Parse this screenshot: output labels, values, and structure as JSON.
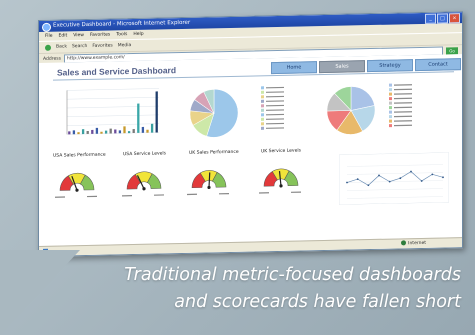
{
  "window": {
    "title": "Executive Dashboard - Microsoft Internet Explorer",
    "controls": [
      "_",
      "□",
      "×"
    ],
    "menu": [
      "File",
      "Edit",
      "View",
      "Favorites",
      "Tools",
      "Help"
    ],
    "toolbar": [
      "Back",
      "Search",
      "Favorites",
      "Media"
    ],
    "address_label": "Address",
    "address": "http://www.example.com/",
    "go": "Go"
  },
  "dashboard": {
    "title": "Sales and Service Dashboard",
    "nav": [
      "Home",
      "Sales",
      "Strategy",
      "Contact"
    ],
    "nav_active": 1,
    "gauges": [
      {
        "title": "USA Sales Performance"
      },
      {
        "title": "USA Service Levels"
      },
      {
        "title": "UK Sales Performance"
      },
      {
        "title": "UK Service Levels"
      }
    ]
  },
  "status": {
    "zone": "Internet"
  },
  "caption": {
    "line1": "Traditional metric-focused dashboards",
    "line2": "and scorecards have fallen short"
  },
  "colors": {
    "gauge_red": "#e2393a",
    "gauge_yellow": "#f1e43a",
    "gauge_green": "#86c35a",
    "nav_blue": "#8fb9e3",
    "title_blue": "#55618a"
  },
  "chart_data": [
    {
      "type": "bar",
      "title": "",
      "values": [
        3,
        4,
        2,
        5,
        3,
        4,
        6,
        2,
        3,
        5,
        4,
        3,
        7,
        2,
        4,
        30,
        6,
        3,
        9,
        42
      ],
      "categories": []
    },
    {
      "type": "pie",
      "values": [
        55,
        12,
        10,
        8,
        8,
        7
      ]
    },
    {
      "type": "pie",
      "values": [
        22,
        20,
        18,
        15,
        13,
        12
      ]
    },
    {
      "type": "line",
      "values": [
        5,
        6,
        4,
        7,
        5,
        6,
        8,
        5,
        7,
        6
      ]
    }
  ]
}
